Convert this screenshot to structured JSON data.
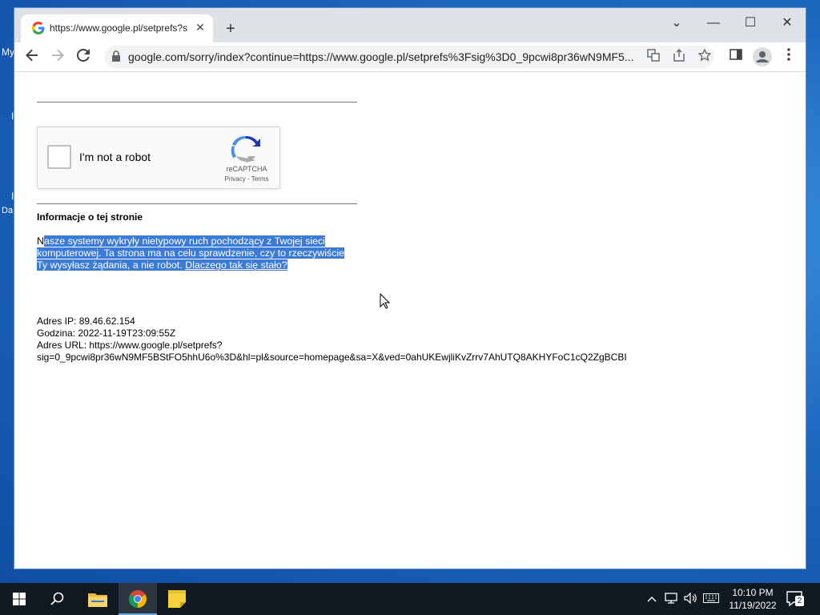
{
  "desktop": {
    "labels": [
      "My",
      "I",
      "I",
      "Da"
    ]
  },
  "browser": {
    "tab_title": "https://www.google.pl/setprefs?s",
    "new_tab_symbol": "+",
    "tab_close_symbol": "✕",
    "window_controls": {
      "dropdown": "⌄",
      "minimize": "—",
      "maximize": "☐",
      "close": "✕"
    },
    "url": "google.com/sorry/index?continue=https://www.google.pl/setprefs%3Fsig%3D0_9pcwi8pr36wN9MF5..."
  },
  "page": {
    "captcha": {
      "checkbox_label": "I'm not a robot",
      "brand": "reCAPTCHA",
      "privacy": "Privacy",
      "separator": " - ",
      "terms": "Terms"
    },
    "section_title": "Informacje o tej stronie",
    "description_first_char": "N",
    "description_rest": "asze systemy wykryły nietypowy ruch pochodzący z Twojej sieci komputerowej. Ta strona ma na celu sprawdzenie, czy to rzeczywiście Ty wysyłasz żądania, a nie robot. ",
    "description_link": "Dlaczego tak się stało?",
    "ip_line": "Adres IP: 89.46.62.154",
    "time_line": "Godzina: 2022-11-19T23:09:55Z",
    "url_line_1": "Adres URL: https://www.google.pl/setprefs?",
    "url_line_2": "sig=0_9pcwi8pr36wN9MF5BStFO5hhU6o%3D&hl=pl&source=homepage&sa=X&ved=0ahUKEwjliKvZrrv7AhUTQ8AKHYFoC1cQ2ZgBCBI"
  },
  "taskbar": {
    "time": "10:10 PM",
    "date": "11/19/2022",
    "notification_count": "2"
  },
  "colors": {
    "selection": "#3b7bd6",
    "taskbar": "#101820",
    "tab_strip": "#dee1e6"
  }
}
